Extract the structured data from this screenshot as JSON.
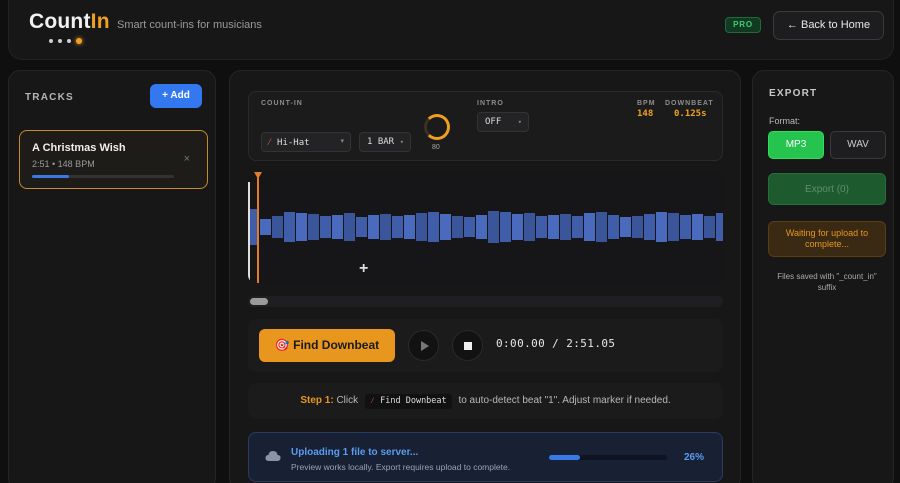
{
  "header": {
    "logo_main": "Count",
    "logo_accent": "In",
    "tagline": "Smart count-ins for musicians",
    "badge": "PRO",
    "back_button": "← Back to Home"
  },
  "tracks": {
    "title": "TRACKS",
    "add_button": "+ Add",
    "items": [
      {
        "name": "A Christmas Wish",
        "meta": "2:51 • 148 BPM",
        "close": "×",
        "progress": 0.26
      }
    ]
  },
  "countin": {
    "label": "COUNT-IN",
    "sound": "Hi-Hat",
    "length": "1 BAR",
    "volume": "80",
    "intro_label": "INTRO",
    "intro_value": "OFF",
    "bpm_label": "BPM",
    "bpm_value": "148",
    "downbeat_label": "DOWNBEAT",
    "downbeat_value": "0.125s"
  },
  "transport": {
    "find_button": "Find Downbeat",
    "time": "0:00.00 / 2:51.05"
  },
  "step": {
    "prefix": "Step 1:",
    "text_before": "Click",
    "chip": "Find Downbeat",
    "text_after": "to auto-detect beat \"1\". Adjust marker if needed."
  },
  "upload": {
    "title": "Uploading 1 file to server...",
    "subtitle": "Preview works locally. Export requires upload to complete.",
    "percent_label": "26%",
    "progress": 0.26
  },
  "export": {
    "title": "EXPORT",
    "format_label": "Format:",
    "formats": [
      "MP3",
      "WAV"
    ],
    "selected_format": "MP3",
    "export_button": "Export (0)",
    "waiting": "Waiting for upload to complete...",
    "note": "Files saved with \"_count_in\" suffix"
  },
  "colors": {
    "accent": "#f0a020",
    "primary_blue": "#3478f0",
    "green": "#25c44e",
    "waveform": "#3f5da8"
  },
  "icons": {
    "cloud": "cloud-icon",
    "drum": "drumstick-icon",
    "target": "target-icon"
  }
}
